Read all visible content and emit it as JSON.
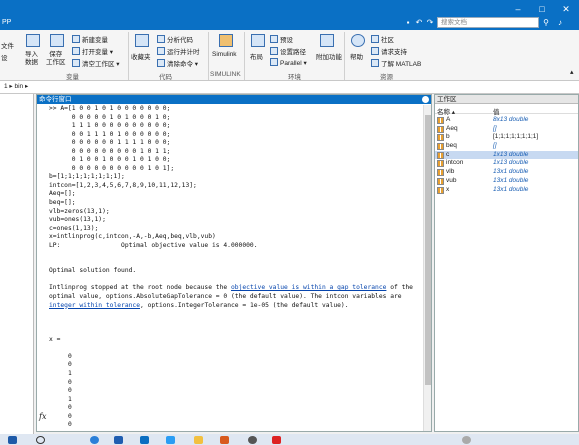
{
  "titlebar": {
    "app_name": "PP",
    "search_placeholder": "搜索文档",
    "minimize": "–",
    "maximize": "□",
    "close": "✕"
  },
  "ribbon": {
    "open_file": "文件",
    "open_sub": "设",
    "import_data": "导入\n数据",
    "save_workspace": "保存\n工作区",
    "new_variable": "新建变量",
    "open_variable": "打开变量",
    "clear_workspace": "清空工作区",
    "favorites": "收藏夹",
    "analyze_code": "分析代码",
    "run_and_time": "运行并计时",
    "clear_commands": "清除命令",
    "simulink": "Simulink",
    "layout": "布局",
    "preferences": "预设",
    "set_path": "设置路径",
    "parallel": "Parallel",
    "addons": "附加功能",
    "help": "帮助",
    "community": "社区",
    "request_support": "请求支持",
    "learn_matlab": "了解 MATLAB",
    "groups": {
      "variable": "变量",
      "code": "代码",
      "simulink": "SIMULINK",
      "environment": "环境",
      "resources": "资源"
    }
  },
  "addressbar": {
    "path": "1 ▸ bin ▸"
  },
  "command_window": {
    "title": "命令行窗口",
    "lines": [
      ">> A=[1 0 0 1 0 1 0 0 0 0 0 0 0;",
      "      0 0 0 0 0 1 0 1 0 0 0 1 0;",
      "      1 1 1 0 0 0 0 0 0 0 0 0 0;",
      "      0 0 1 1 1 0 1 0 0 0 0 0 0;",
      "      0 0 0 0 0 0 1 1 1 1 0 0 0;",
      "      0 0 0 0 0 0 0 0 0 1 0 1 1;",
      "      0 1 0 0 1 0 0 0 1 0 1 0 0;",
      "      0 0 0 0 0 0 0 0 0 0 1 0 1];",
      "b=[1;1;1;1;1;1;1;1];",
      "intcon=[1,2,3,4,5,6,7,8,9,10,11,12,13];",
      "Aeq=[];",
      "beq=[];",
      "vlb=zeros(13,1);",
      "vub=ones(13,1);",
      "c=ones(1,13);",
      "x=intlinprog(c,intcon,-A,-b,Aeq,beq,vlb,vub)",
      "LP:                Optimal objective value is 4.000000.",
      "",
      "",
      "Optimal solution found.",
      "",
      "@stop",
      "optimal value, options.AbsoluteGapTolerance = 0 (the default value). The intcon variables are",
      "@int",
      "",
      "",
      "",
      "x =",
      "",
      "     0",
      "     0",
      "     1",
      "     0",
      "     0",
      "     1",
      "     0",
      "     0",
      "     0"
    ],
    "stop_pre": "Intlinprog stopped at the root node because the ",
    "stop_link": "objective value is within a gap tolerance",
    "stop_post": " of the",
    "int_link": "integer within tolerance",
    "int_post": ", options.IntegerTolerance = 1e-05 (the default value).",
    "fx_label": "fx"
  },
  "workspace": {
    "title": "工作区",
    "col_name": "名称 ▴",
    "col_value": "值",
    "variables": [
      {
        "name": "A",
        "value": "8x13 double",
        "style": "link"
      },
      {
        "name": "Aeq",
        "value": "[]",
        "style": "link"
      },
      {
        "name": "b",
        "value": "[1;1;1;1;1;1;1;1]",
        "style": "plain"
      },
      {
        "name": "beq",
        "value": "[]",
        "style": "link"
      },
      {
        "name": "c",
        "value": "1x13 double",
        "style": "link",
        "selected": true
      },
      {
        "name": "intcon",
        "value": "1x13 double",
        "style": "link"
      },
      {
        "name": "vlb",
        "value": "13x1 double",
        "style": "link"
      },
      {
        "name": "vub",
        "value": "13x1 double",
        "style": "link"
      },
      {
        "name": "x",
        "value": "13x1 double",
        "style": "link"
      }
    ]
  },
  "colors": {
    "accent": "#0a70c5",
    "link": "#0645ad",
    "selected_row": "#c7d9f1"
  }
}
